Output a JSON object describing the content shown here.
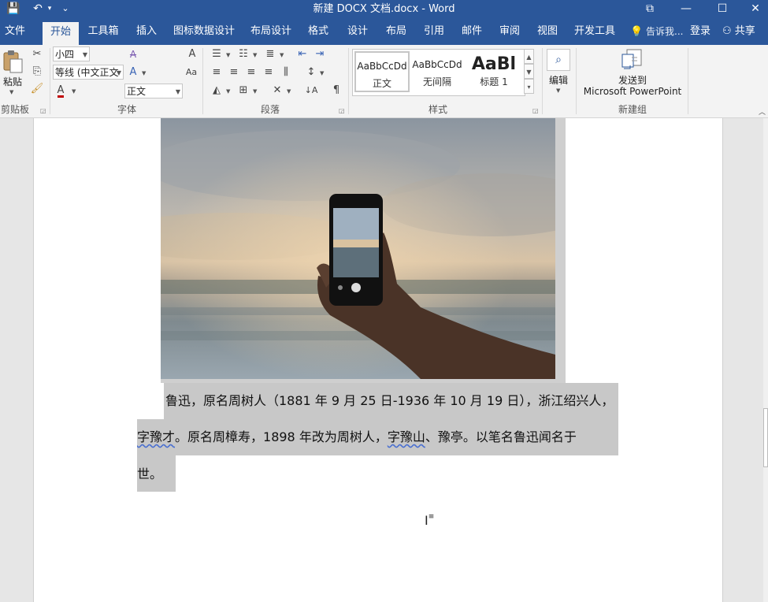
{
  "window": {
    "title": "新建 DOCX 文档.docx - Word",
    "controls": {
      "ribbon_display": "⧉",
      "minimize": "—",
      "maximize": "☐",
      "close": "✕"
    }
  },
  "quick_access": {
    "save": "💾",
    "undo": "↶",
    "undo_dropdown": "▾",
    "customize": "⌄"
  },
  "tabs": [
    {
      "label": "文件"
    },
    {
      "label": "开始",
      "active": true
    },
    {
      "label": "工具箱"
    },
    {
      "label": "插入"
    },
    {
      "label": "图标数据设计"
    },
    {
      "label": "布局设计"
    },
    {
      "label": "格式"
    },
    {
      "label": "设计"
    },
    {
      "label": "布局"
    },
    {
      "label": "引用"
    },
    {
      "label": "邮件"
    },
    {
      "label": "审阅"
    },
    {
      "label": "视图"
    },
    {
      "label": "开发工具"
    }
  ],
  "tell_me": "告诉我...",
  "login": "登录",
  "share": "共享",
  "ribbon": {
    "clipboard": {
      "paste_label": "粘贴",
      "group_label": "剪贴板"
    },
    "font": {
      "size_value": "小四",
      "font_value": "等线 (中文正文",
      "style_value": "正文",
      "group_label": "字体",
      "clear_format_glyph": "A",
      "grow_glyph": "A",
      "case_glyph": "Aa",
      "color_glyph": "A",
      "accent_color": "#c00000"
    },
    "paragraph": {
      "group_label": "段落"
    },
    "styles": {
      "group_label": "样式",
      "items": [
        {
          "preview": "AaBbCcDd",
          "name": "正文"
        },
        {
          "preview": "AaBbCcDd",
          "name": "无间隔"
        },
        {
          "preview": "AaBl",
          "name": "标题 1"
        }
      ]
    },
    "editing": {
      "label": "编辑"
    },
    "new_group": {
      "send_line1": "发送到",
      "send_line2": "Microsoft PowerPoint",
      "group_label": "新建组"
    }
  },
  "document": {
    "line1": "鲁迅，原名周树人（1881 年 9 月 25 日-1936 年 10 月 19 日），浙江绍兴人，",
    "line2_a": "字豫才",
    "line2_b": "。原名周樟寿，1898  年改为周树人，",
    "line2_c": "字豫山",
    "line2_d": "、豫亭。以笔名鲁迅闻名于",
    "line3": "世。"
  },
  "colors": {
    "title_bar": "#2b579a",
    "selection": "#c8c8c8",
    "ribbon_bg": "#f3f3f3"
  }
}
